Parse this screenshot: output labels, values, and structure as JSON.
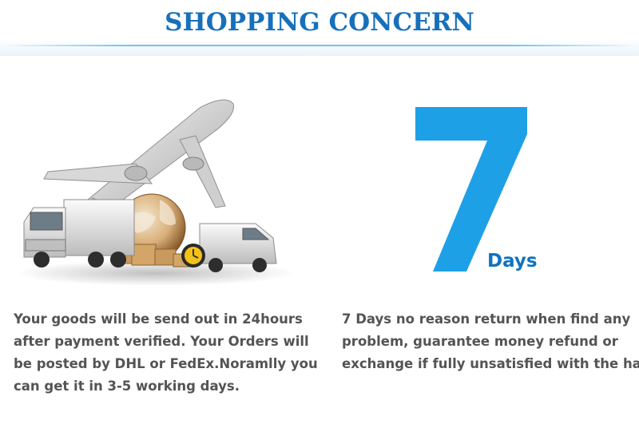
{
  "header": {
    "title": "SHOPPING CONCERN"
  },
  "shipping": {
    "illustration_icon": "shipping-plane-truck-globe-icon",
    "lines": [
      "Your goods will be send out in 24hours",
      "after payment verified. Your Orders will",
      "be posted by DHL or FedEx.Noramlly you",
      "can get it in 3-5 working days."
    ]
  },
  "returns": {
    "number": "7",
    "unit": "Days",
    "lines": [
      "7 Days no reason return when find any",
      "problem, guarantee money refund or",
      "exchange if fully unsatisfied with the hair"
    ]
  },
  "colors": {
    "accent": "#1670bc",
    "seven": "#1ea0e6",
    "body_text": "#555353"
  }
}
